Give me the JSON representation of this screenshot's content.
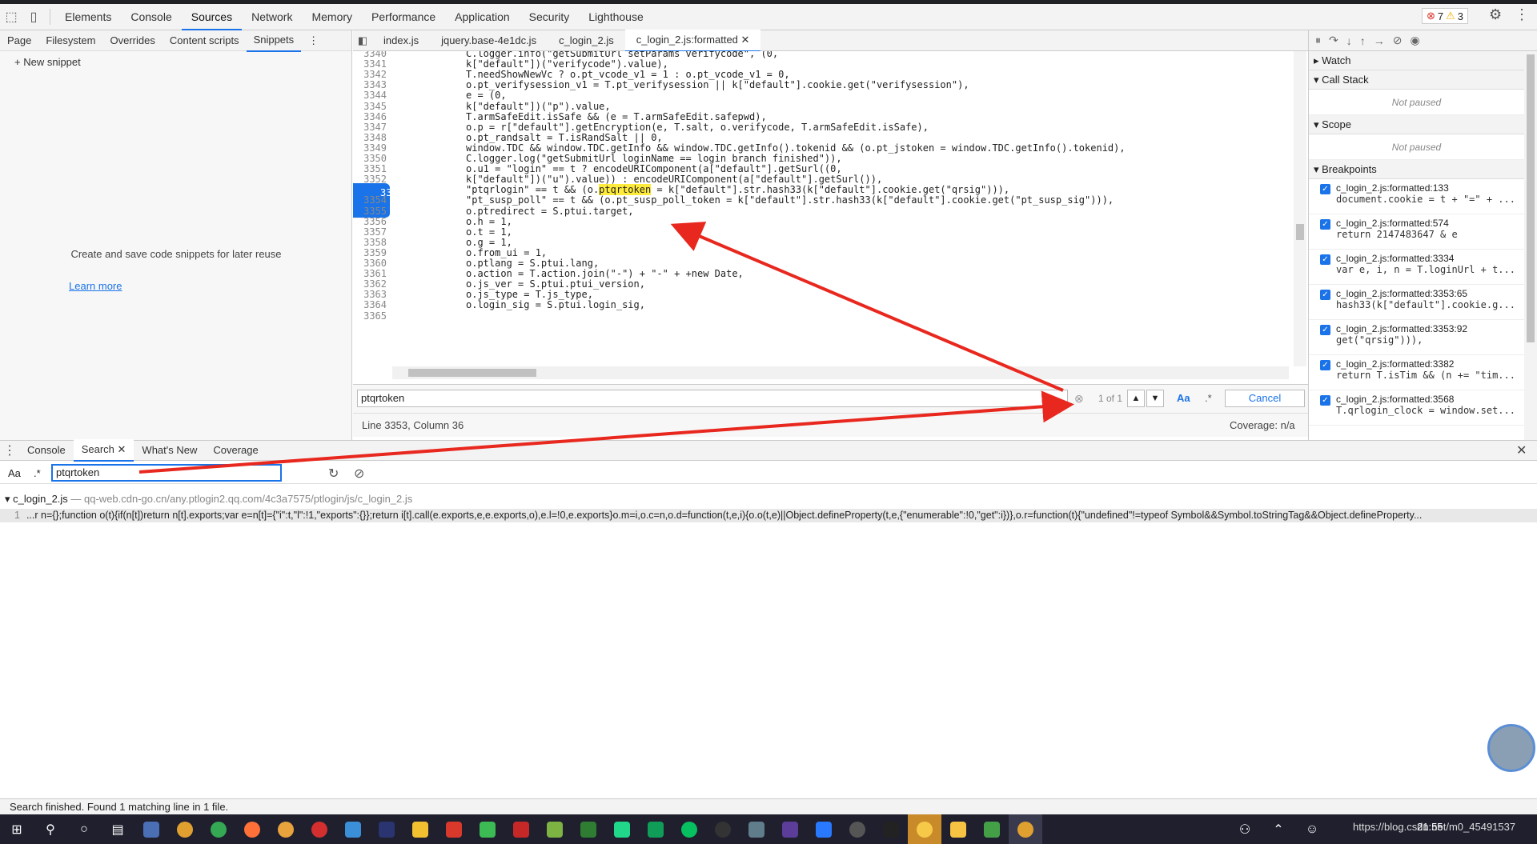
{
  "toolbar": {
    "panels": [
      "Elements",
      "Console",
      "Sources",
      "Network",
      "Memory",
      "Performance",
      "Application",
      "Security",
      "Lighthouse"
    ],
    "active_panel": "Sources",
    "errors": "7",
    "warnings": "3"
  },
  "navigator": {
    "tabs": [
      "Page",
      "Filesystem",
      "Overrides",
      "Content scripts",
      "Snippets"
    ],
    "active_tab": "Snippets",
    "new_snippet": "New snippet",
    "description": "Create and save code snippets for later reuse",
    "learn_more": "Learn more"
  },
  "editor": {
    "tabs": [
      "index.js",
      "jquery.base-4e1dc.js",
      "c_login_2.js",
      "c_login_2.js:formatted"
    ],
    "active_tab": "c_login_2.js:formatted",
    "lines": [
      {
        "n": "3340",
        "code": "C.logger.info(\"getSubmitUrl setParams verifycode\", (0,"
      },
      {
        "n": "3341",
        "code": "k[\"default\"])(\"verifycode\").value),"
      },
      {
        "n": "3342",
        "code": "T.needShowNewVc ? o.pt_vcode_v1 = 1 : o.pt_vcode_v1 = 0,"
      },
      {
        "n": "3343",
        "code": "o.pt_verifysession_v1 = T.pt_verifysession || k[\"default\"].cookie.get(\"verifysession\"),"
      },
      {
        "n": "3344",
        "code": "e = (0,"
      },
      {
        "n": "3345",
        "code": "k[\"default\"])(\"p\").value,"
      },
      {
        "n": "3346",
        "code": "T.armSafeEdit.isSafe && (e = T.armSafeEdit.safepwd),"
      },
      {
        "n": "3347",
        "code": "o.p = r[\"default\"].getEncryption(e, T.salt, o.verifycode, T.armSafeEdit.isSafe),"
      },
      {
        "n": "3348",
        "code": "o.pt_randsalt = T.isRandSalt || 0,"
      },
      {
        "n": "3349",
        "code": "window.TDC && window.TDC.getInfo && window.TDC.getInfo().tokenid && (o.pt_jstoken = window.TDC.getInfo().tokenid),"
      },
      {
        "n": "3350",
        "code": "C.logger.log(\"getSubmitUrl loginName == login branch finished\")),"
      },
      {
        "n": "3351",
        "code": "o.u1 = \"login\" == t ? encodeURIComponent(a[\"default\"].getSurl((0,"
      },
      {
        "n": "3352",
        "code": "k[\"default\"])(\"u\").value)) : encodeURIComponent(a[\"default\"].getSurl()),"
      },
      {
        "n": "3353",
        "code_pre": "\"ptqrlogin\" == t && (o.",
        "code_hl": "ptqrtoken",
        "code_post": " = k[\"default\"].str.hash33(k[\"default\"].cookie.get(\"qrsig\"))),"
      },
      {
        "n": "3354",
        "code": "\"pt_susp_poll\" == t && (o.pt_susp_poll_token = k[\"default\"].str.hash33(k[\"default\"].cookie.get(\"pt_susp_sig\"))),"
      },
      {
        "n": "3355",
        "code": "o.ptredirect = S.ptui.target,"
      },
      {
        "n": "3356",
        "code": "o.h = 1,"
      },
      {
        "n": "3357",
        "code": "o.t = 1,"
      },
      {
        "n": "3358",
        "code": "o.g = 1,"
      },
      {
        "n": "3359",
        "code": "o.from_ui = 1,"
      },
      {
        "n": "3360",
        "code": "o.ptlang = S.ptui.lang,"
      },
      {
        "n": "3361",
        "code": "o.action = T.action.join(\"-\") + \"-\" + +new Date,"
      },
      {
        "n": "3362",
        "code": "o.js_ver = S.ptui.ptui_version,"
      },
      {
        "n": "3363",
        "code": "o.js_type = T.js_type,"
      },
      {
        "n": "3364",
        "code": "o.login_sig = S.ptui.login_sig,"
      },
      {
        "n": "3365",
        "code": ""
      }
    ],
    "breakpoint_line": "3353",
    "find_value": "ptqrtoken",
    "find_count": "1 of 1",
    "find_case": "Aa",
    "find_regex": ".*",
    "cancel": "Cancel",
    "position": "Line 3353, Column 36",
    "coverage": "Coverage: n/a"
  },
  "debugger": {
    "watch": "Watch",
    "call_stack": "Call Stack",
    "scope": "Scope",
    "not_paused": "Not paused",
    "breakpoints_title": "Breakpoints",
    "breakpoints": [
      {
        "file": "c_login_2.js:formatted:133",
        "src": "document.cookie = t + \"=\" + ..."
      },
      {
        "file": "c_login_2.js:formatted:574",
        "src": "return 2147483647 & e"
      },
      {
        "file": "c_login_2.js:formatted:3334",
        "src": "var e, i, n = T.loginUrl + t..."
      },
      {
        "file": "c_login_2.js:formatted:3353:65",
        "src": "hash33(k[\"default\"].cookie.g..."
      },
      {
        "file": "c_login_2.js:formatted:3353:92",
        "src": "get(\"qrsig\"))),"
      },
      {
        "file": "c_login_2.js:formatted:3382",
        "src": "return T.isTim && (n += \"tim..."
      },
      {
        "file": "c_login_2.js:formatted:3568",
        "src": "T.qrlogin_clock = window.set..."
      }
    ]
  },
  "drawer": {
    "tabs": [
      "Console",
      "Search",
      "What's New",
      "Coverage"
    ],
    "active_tab": "Search",
    "case_label": "Aa",
    "regex_label": ".*",
    "search_value": "ptqrtoken",
    "result_file": "c_login_2.js",
    "result_url": " — qq-web.cdn-go.cn/any.ptlogin2.qq.com/4c3a7575/ptlogin/js/c_login_2.js",
    "result_line_no": "1",
    "result_line": "...r n={};function o(t){if(n[t])return n[t].exports;var e=n[t]={\"i\":t,\"l\":!1,\"exports\":{}};return i[t].call(e.exports,e,e.exports,o),e.l=!0,e.exports}o.m=i,o.c=n,o.d=function(t,e,i){o.o(t,e)||Object.defineProperty(t,e,{\"enumerable\":!0,\"get\":i})},o.r=function(t){\"undefined\"!=typeof Symbol&&Symbol.toStringTag&&Object.defineProperty...",
    "status": "Search finished.  Found 1 matching line in 1 file."
  },
  "taskbar": {
    "clock": "21:55",
    "watermark": "https://blog.csdn.net/m0_45491537"
  },
  "colors": {
    "accent": "#1a73e8",
    "arrow": "#e8281e",
    "highlight": "#ffeb3b"
  }
}
